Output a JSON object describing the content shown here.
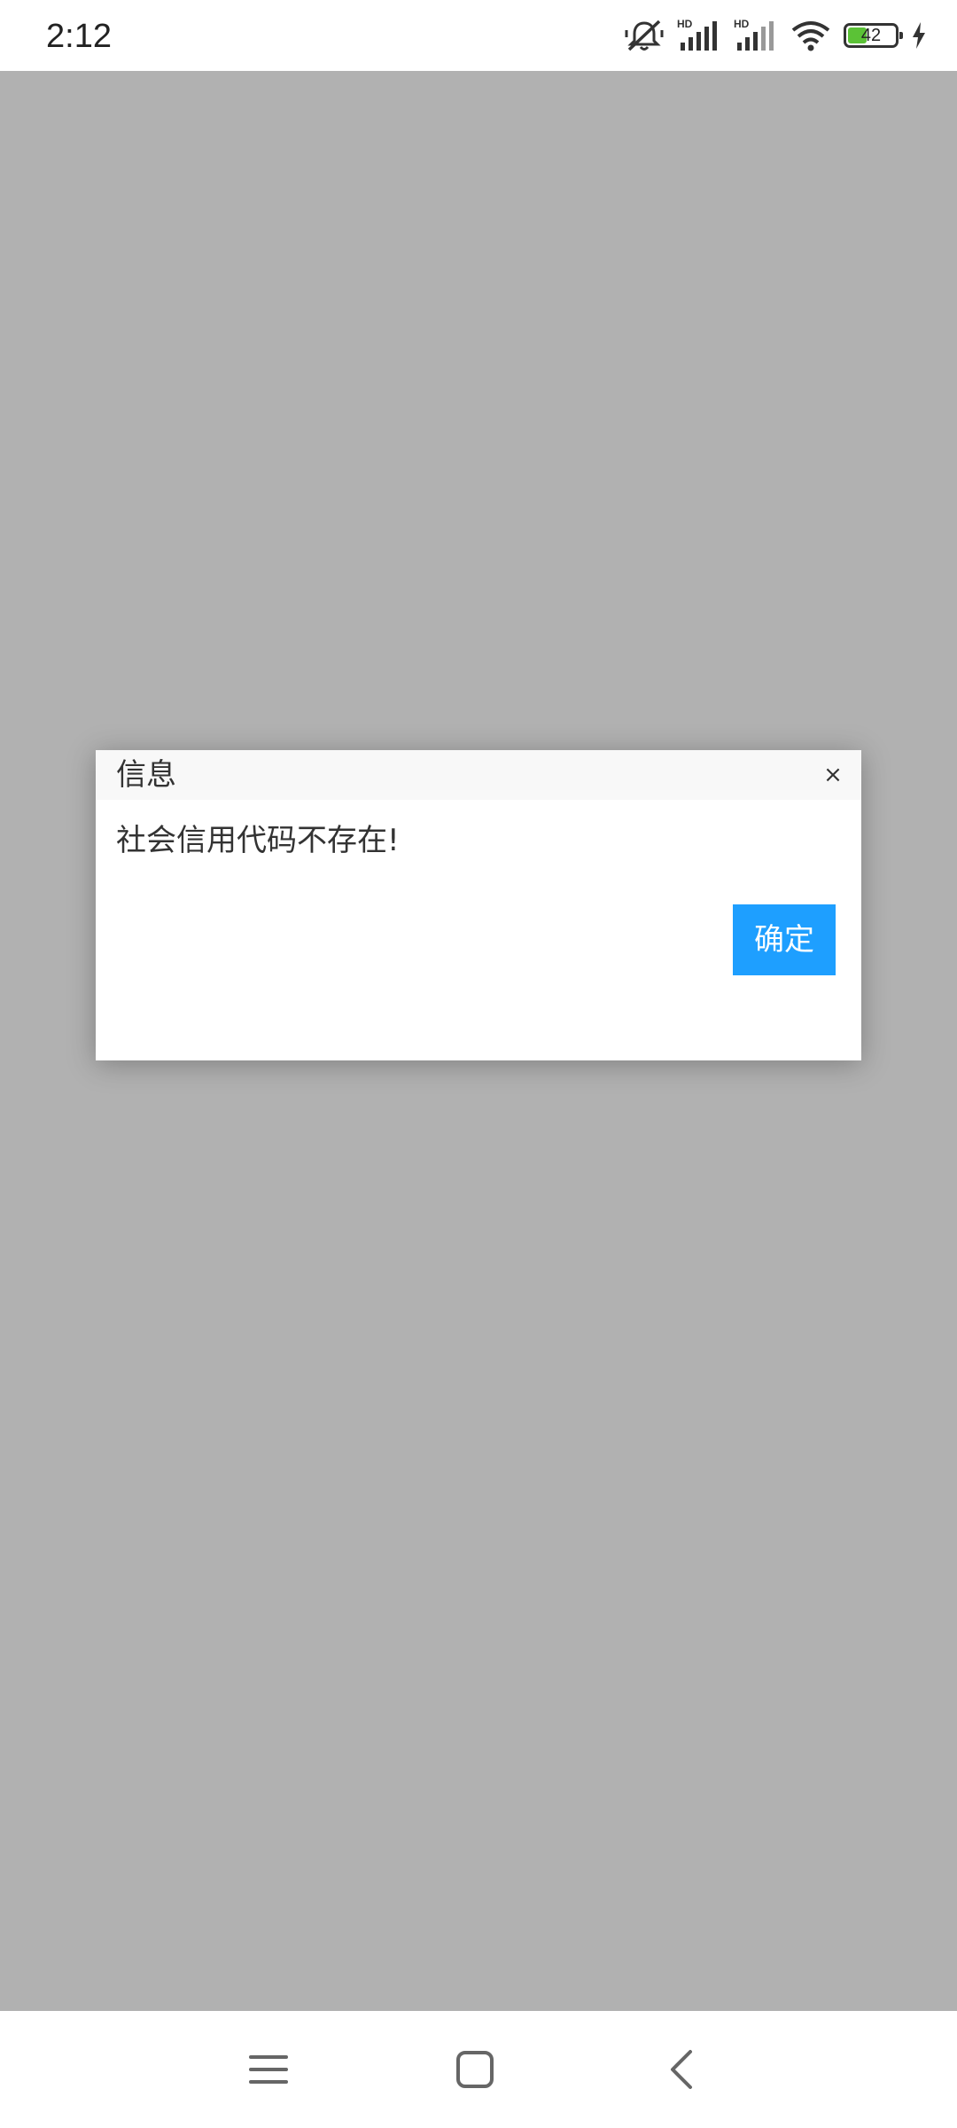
{
  "status_bar": {
    "time": "2:12",
    "battery_level": "42",
    "battery_fill_percent": 42,
    "icons": [
      "mute-icon",
      "signal-hd-1-icon",
      "signal-hd-2-icon",
      "wifi-icon",
      "battery-icon",
      "charging-icon"
    ],
    "signal_label": "HD"
  },
  "dialog": {
    "title": "信息",
    "close_label": "×",
    "message": "社会信用代码不存在!",
    "ok_label": "确定",
    "accent_color": "#1e9fff"
  },
  "background": {
    "overlay_color": "#b1b1b1"
  },
  "nav_bar": {
    "buttons": [
      "menu-icon",
      "home-icon",
      "back-icon"
    ]
  }
}
